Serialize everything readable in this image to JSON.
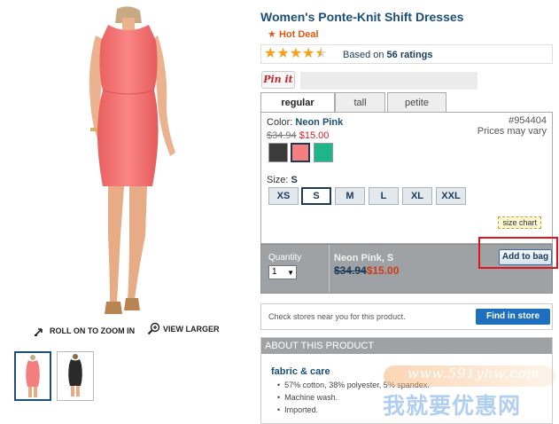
{
  "product": {
    "title": "Women's Ponte-Knit Shift Dresses",
    "hot_deal": "Hot Deal",
    "hot_deal_star": "★",
    "rating_value": 4.5,
    "rating_prefix": "Based on",
    "rating_count": "56 ratings",
    "star_icons": [
      "★",
      "★",
      "★",
      "★",
      "★"
    ]
  },
  "share": {
    "pinit_label": "Pin it"
  },
  "fit_tabs": [
    {
      "label": "regular",
      "active": true
    },
    {
      "label": "tall",
      "active": false
    },
    {
      "label": "petite",
      "active": false
    }
  ],
  "color": {
    "label": "Color:",
    "value": "Neon Pink",
    "sku": "#954404",
    "price_note": "Prices may vary",
    "original_price": "$34.94",
    "sale_price": "$15.00",
    "swatches": [
      {
        "name": "Black",
        "hex": "#3b3b3b",
        "selected": false
      },
      {
        "name": "Neon Pink",
        "hex": "#f47f7f",
        "selected": true
      },
      {
        "name": "Green",
        "hex": "#1fb58a",
        "selected": false
      }
    ]
  },
  "size": {
    "label": "Size:",
    "value": "S",
    "options": [
      {
        "label": "XS",
        "selected": false
      },
      {
        "label": "S",
        "selected": true
      },
      {
        "label": "M",
        "selected": false
      },
      {
        "label": "L",
        "selected": false
      },
      {
        "label": "XL",
        "selected": false
      },
      {
        "label": "XXL",
        "selected": false
      }
    ],
    "chart_label": "size chart"
  },
  "cart": {
    "quantity_label": "Quantity",
    "quantity_value": "1",
    "summary_name": "Neon Pink, S",
    "summary_original_price": "$34.94",
    "summary_sale_price": "$15.00",
    "add_button": "Add to bag"
  },
  "stores": {
    "text": "Check stores near you for this product.",
    "button": "Find in store"
  },
  "about": {
    "header": "ABOUT THIS PRODUCT",
    "fabric_title": "fabric & care",
    "items": [
      "57% cotton, 38% polyester, 5% spandex.",
      "Machine wash.",
      "Imported."
    ]
  },
  "image_links": {
    "zoom": "ROLL ON TO ZOOM IN",
    "larger": "VIEW LARGER"
  },
  "watermark": {
    "url": "www.591yhw.com",
    "text": "我就要优惠网"
  },
  "colors": {
    "brand_blue": "#1b4f7a",
    "sale_red": "#c8232c",
    "highlight_red": "#e0141e",
    "panel_gray": "#9fa2a4"
  }
}
